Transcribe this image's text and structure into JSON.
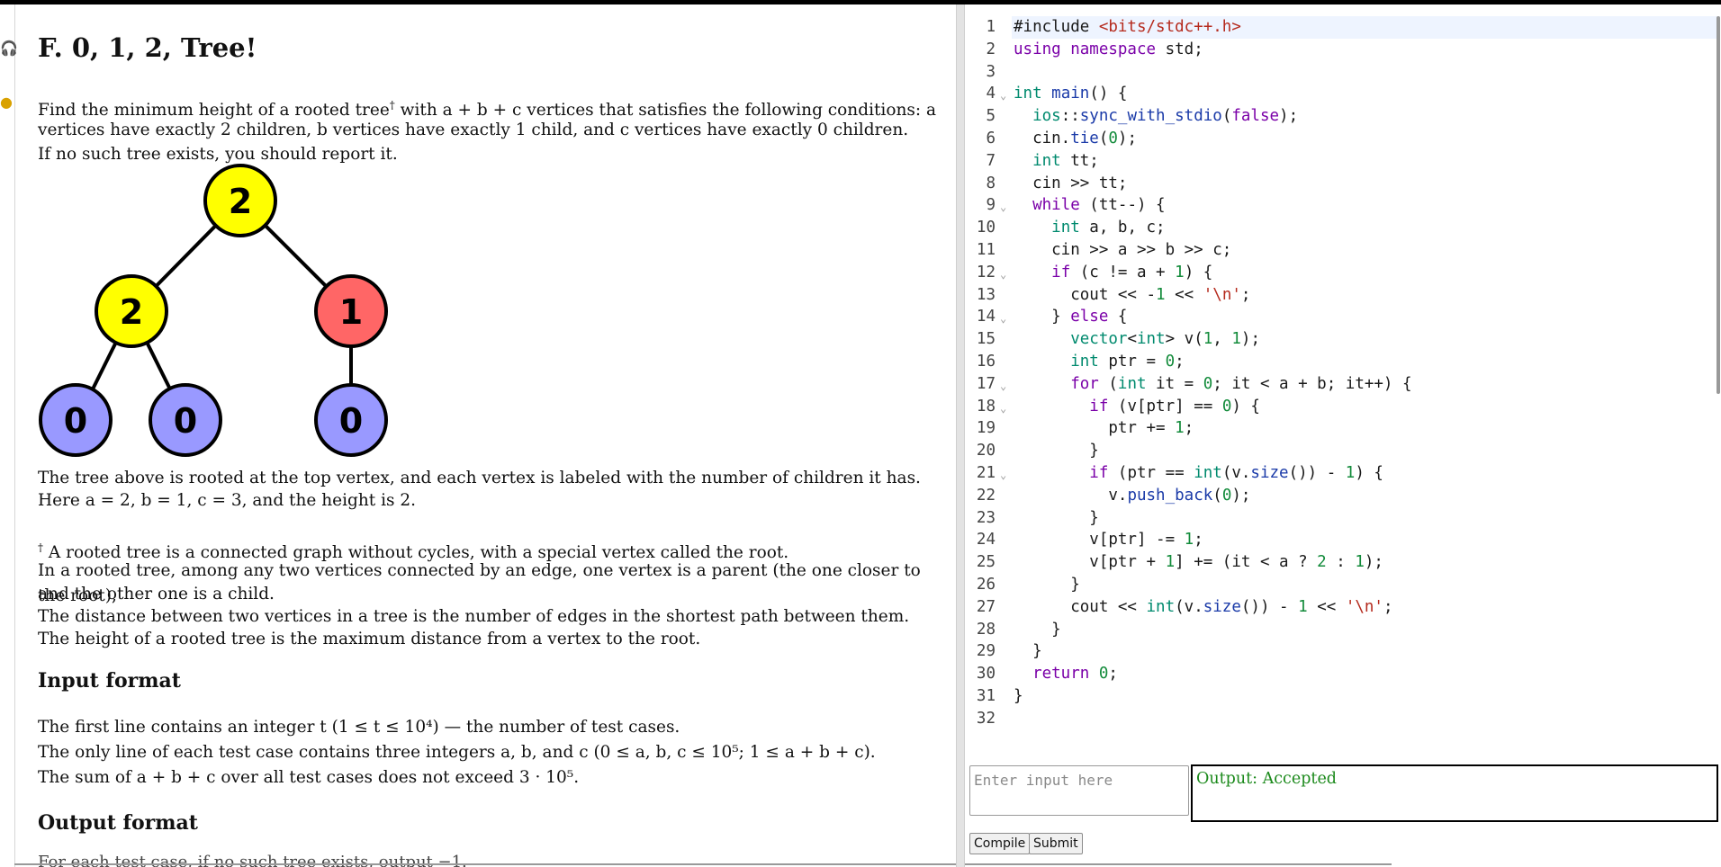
{
  "problem": {
    "title": "F. 0, 1, 2, Tree!",
    "statement": {
      "line1_pre": "Find the minimum height of a rooted tree",
      "dagger": "†",
      "line1_post": " with a + b + c vertices that satisfies the following conditions: a",
      "line2": "vertices have exactly 2 children, b vertices have exactly 1 child, and c vertices have exactly 0 children.",
      "line3": "If no such tree exists, you should report it."
    },
    "tree_labels": {
      "root": "2",
      "left": "2",
      "right": "1",
      "ll": "0",
      "lr": "0",
      "rc": "0"
    },
    "after_tree": {
      "line1": "The tree above is rooted at the top vertex, and each vertex is labeled with the number of children it has.",
      "line2": "Here a = 2, b = 1, c = 3, and the height is 2."
    },
    "footnote": {
      "dagger": "†",
      "line1": " A rooted tree is a connected graph without cycles, with a special vertex called the root.",
      "line2": "In a rooted tree, among any two vertices connected by an edge, one vertex is a parent (the one closer to the root),",
      "line3": "and the other one is a child.",
      "line4": "The distance between two vertices in a tree is the number of edges in the shortest path between them.",
      "line5": "The height of a rooted tree is the maximum distance from a vertex to the root."
    },
    "input_heading": "Input format",
    "input": {
      "line1": "The first line contains an integer t (1 ≤ t ≤ 10⁴) — the number of test cases.",
      "line2": "The only line of each test case contains three integers a, b, and c (0 ≤ a, b, c ≤ 10⁵; 1 ≤ a + b + c).",
      "line3": "The sum of a + b + c over all test cases does not exceed 3 · 10⁵."
    },
    "output_heading": "Output format",
    "output_partial": "For each test case, if no such tree exists, output −1."
  },
  "editor": {
    "lines": [
      "1",
      "2",
      "3",
      "4",
      "5",
      "6",
      "7",
      "8",
      "9",
      "10",
      "11",
      "12",
      "13",
      "14",
      "15",
      "16",
      "17",
      "18",
      "19",
      "20",
      "21",
      "22",
      "23",
      "24",
      "25",
      "26",
      "27",
      "28",
      "29",
      "30",
      "31",
      "32"
    ]
  },
  "io": {
    "input_placeholder": "Enter input here",
    "output_text": "Output: Accepted",
    "output_color": "#1c8a1c"
  },
  "buttons": {
    "compile": "Compile",
    "submit": "Submit"
  },
  "colors": {
    "yellow_node": "#ffff00",
    "red_node": "#ff6666",
    "purple_node": "#9999ff"
  }
}
